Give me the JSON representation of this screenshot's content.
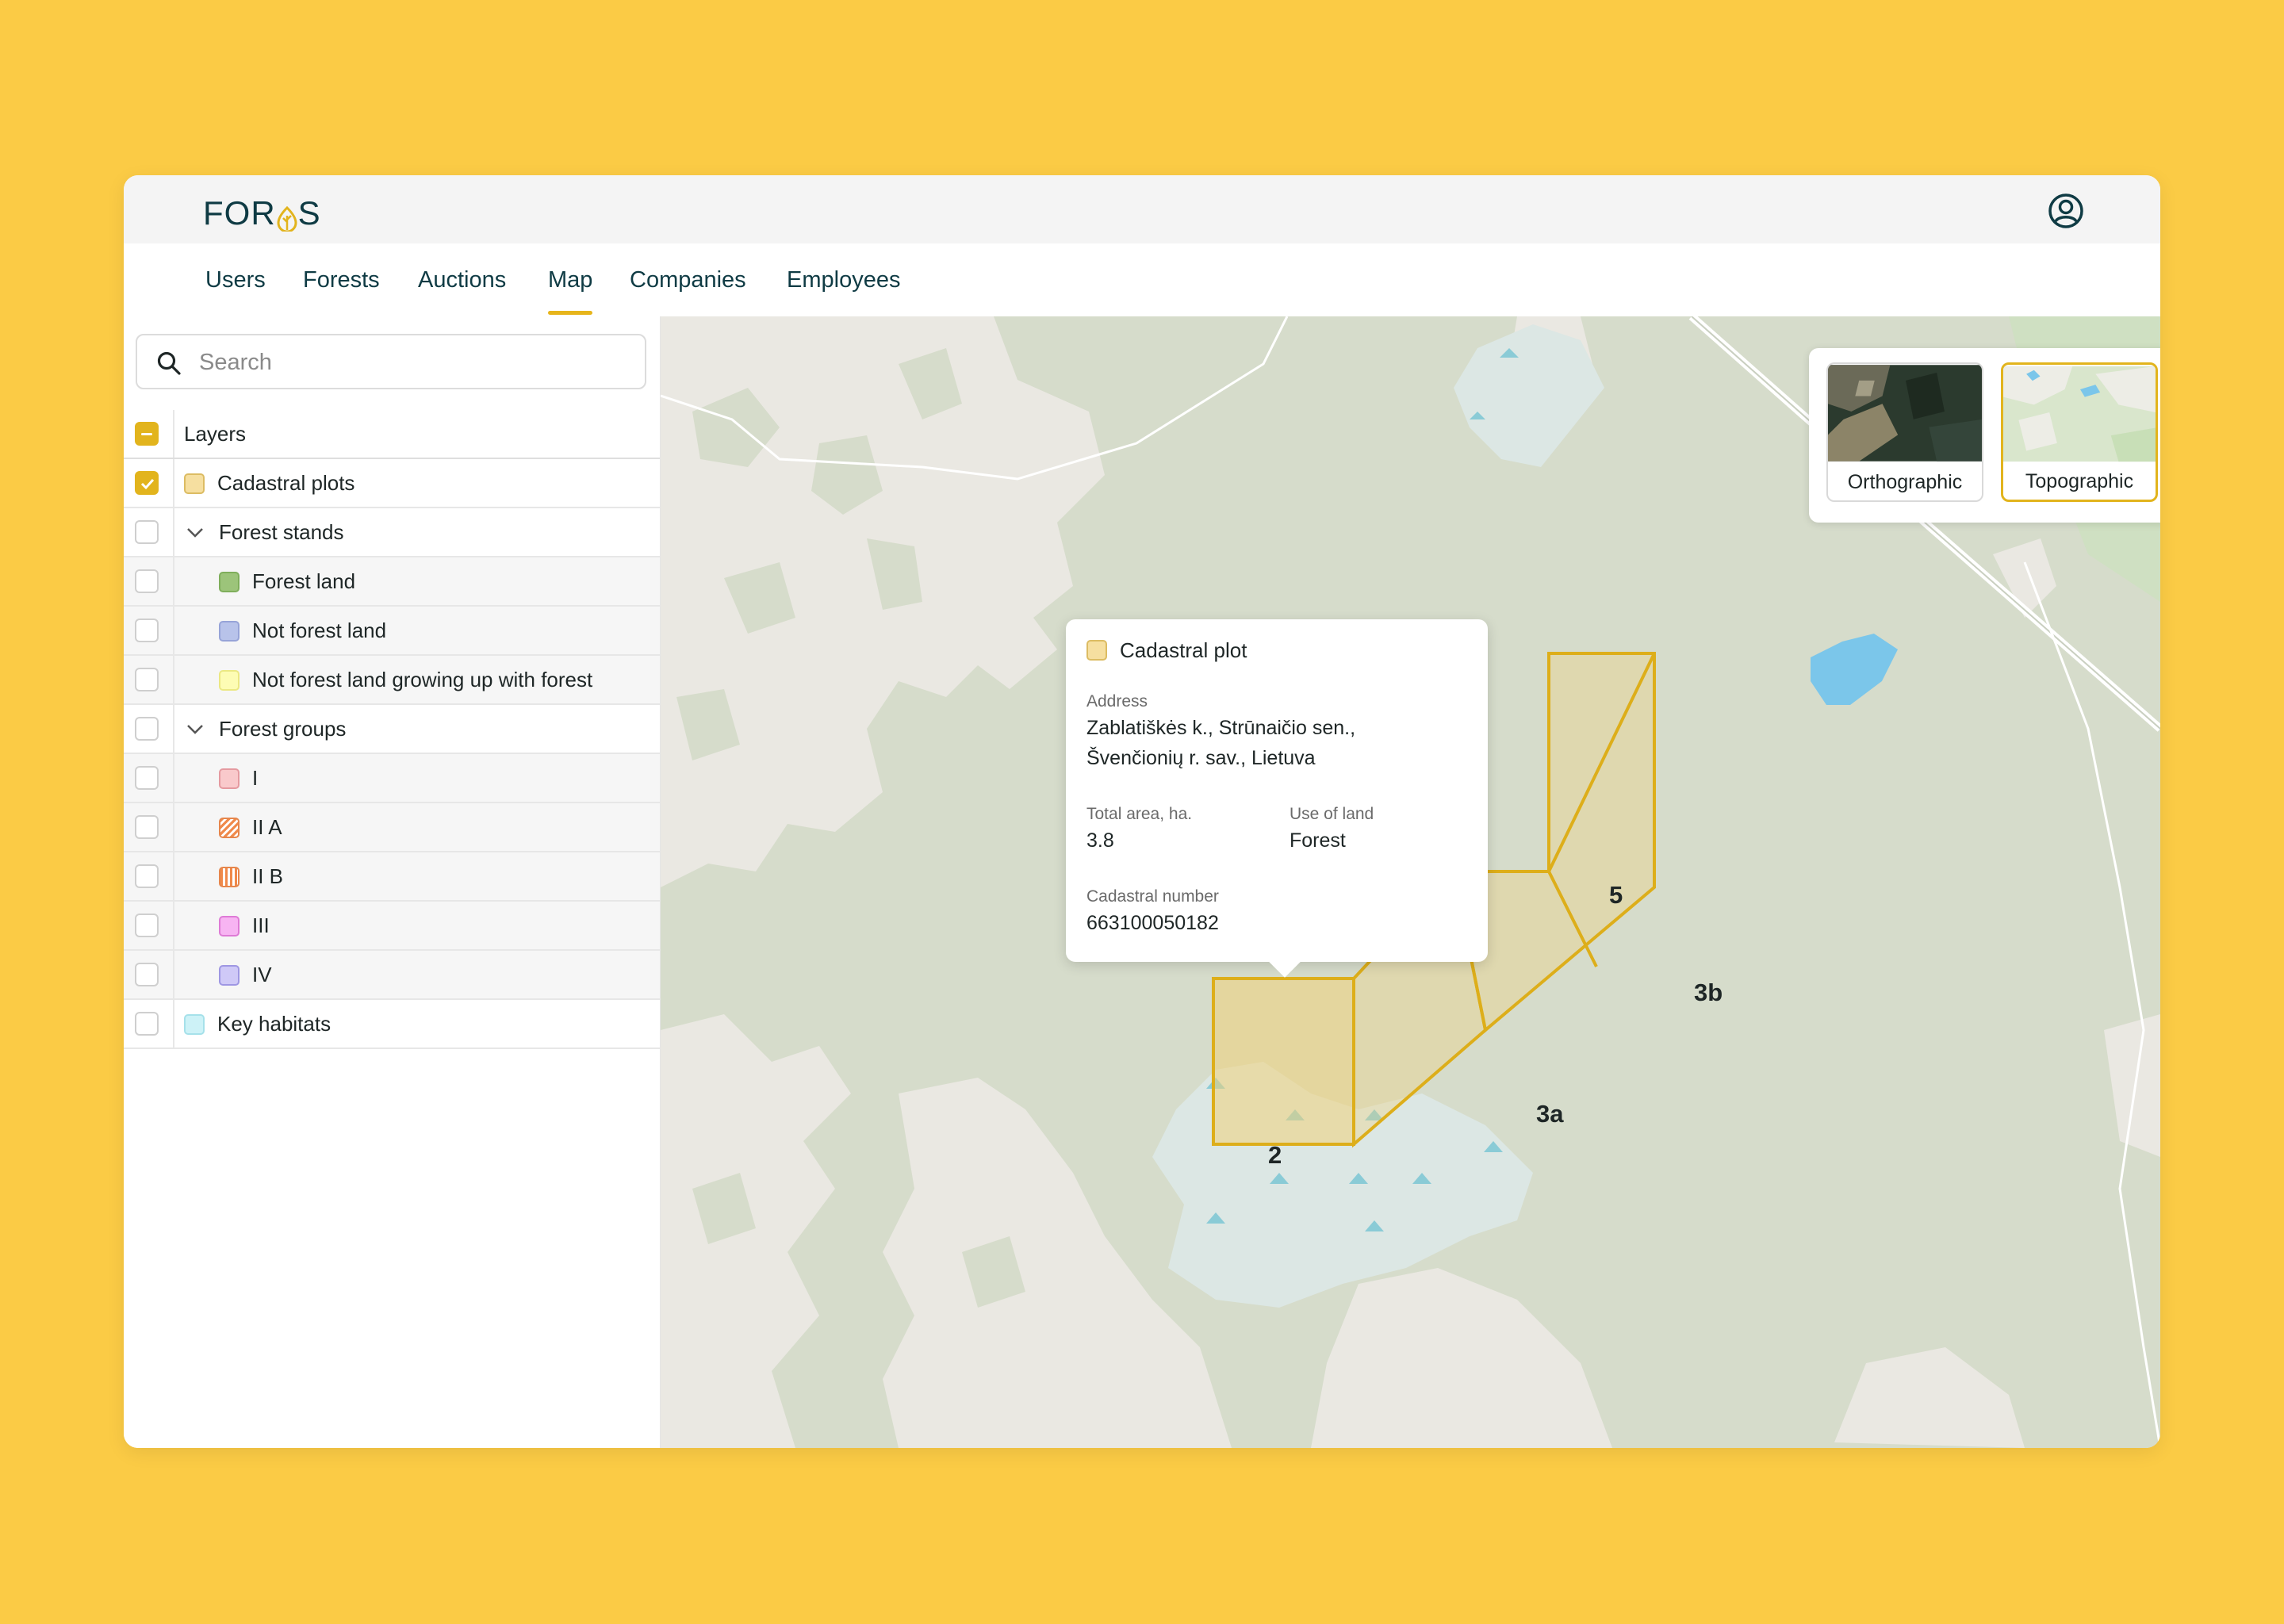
{
  "app": {
    "logo_text_left": "FOR",
    "logo_text_right": "S"
  },
  "nav": {
    "items": [
      {
        "label": "Users"
      },
      {
        "label": "Forests"
      },
      {
        "label": "Auctions"
      },
      {
        "label": "Map",
        "active": true
      },
      {
        "label": "Companies"
      },
      {
        "label": "Employees"
      }
    ]
  },
  "sidebar": {
    "search_placeholder": "Search",
    "layers_header": "Layers",
    "layers": [
      {
        "label": "Cadastral plots",
        "checked": true,
        "swatch": "#F6DFA0"
      },
      {
        "label": "Forest stands",
        "checked": false,
        "expandable": true
      },
      {
        "label": "Forest land",
        "checked": false,
        "swatch": "#9CC47A"
      },
      {
        "label": "Not forest land",
        "checked": false,
        "swatch": "#B8C3EA"
      },
      {
        "label": "Not forest land growing up with forest",
        "checked": false,
        "swatch": "#FDFCB4"
      },
      {
        "label": "Forest groups",
        "checked": false,
        "expandable": true
      },
      {
        "label": "I",
        "checked": false,
        "swatch": "#F9C9CB"
      },
      {
        "label": "II A",
        "checked": false,
        "swatch": "hatched-diagonal-orange"
      },
      {
        "label": "II B",
        "checked": false,
        "swatch": "hatched-vertical-orange"
      },
      {
        "label": "III",
        "checked": false,
        "swatch": "#F7B4F2"
      },
      {
        "label": "IV",
        "checked": false,
        "swatch": "#CFC9F7"
      },
      {
        "label": "Key habitats",
        "checked": false,
        "swatch": "#CDF2F7"
      }
    ]
  },
  "map": {
    "basemaps": [
      {
        "label": "Orthographic",
        "selected": false
      },
      {
        "label": "Topographic",
        "selected": true
      }
    ],
    "plot_labels": [
      "2",
      "3a",
      "3b",
      "5"
    ],
    "controls": {
      "zoom_in": "+",
      "zoom_out": "−",
      "layers_icon": "map-icon"
    }
  },
  "popup": {
    "title": "Cadastral plot",
    "address_label": "Address",
    "address_line1": "Zablatiškės k., Strūnaičio sen.,",
    "address_line2": "Švenčionių r. sav., Lietuva",
    "area_label": "Total area, ha.",
    "area_value": "3.8",
    "use_label": "Use of land",
    "use_value": "Forest",
    "cadastral_label": "Cadastral number",
    "cadastral_value": "663100050182"
  },
  "colors": {
    "accent": "#E2B41D",
    "background": "#FBCB45",
    "nav_text": "#0f3b44"
  }
}
